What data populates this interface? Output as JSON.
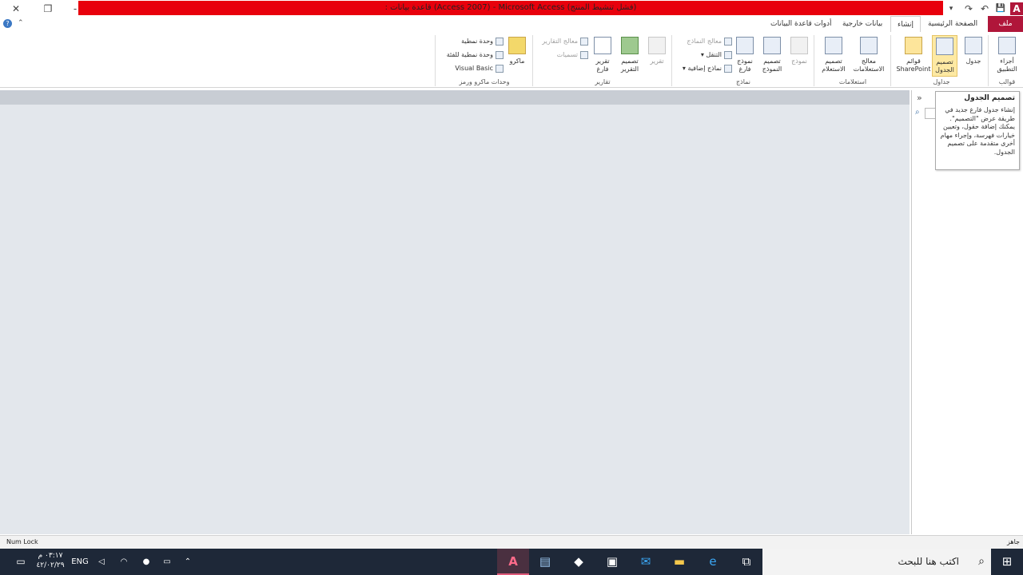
{
  "window": {
    "title": ": قاعدة بيانات  (Access  2007) - Microsoft Access (فشل تنشيط المنتج)",
    "close": "✕",
    "restore": "❐",
    "title_dash": "-",
    "help": "?",
    "qat": [
      "A",
      "💾",
      "↶",
      "↷",
      "▾"
    ]
  },
  "tabs": {
    "file": "ملف",
    "home": "الصفحة الرئيسية",
    "create": "إنشاء",
    "external": "بيانات خارجية",
    "dbtools": "أدوات قاعدة البيانات"
  },
  "ribbon": {
    "templates": {
      "label": "قوالب",
      "app_parts": "أجزاء التطبيق"
    },
    "tables": {
      "label": "جداول",
      "table": "جدول",
      "table_design": "تصميم الجدول",
      "sharepoint_lists": "قوائم SharePoint"
    },
    "queries": {
      "label": "استعلامات",
      "query_wizard": "معالج الاستعلامات",
      "query_design": "تصميم الاستعلام"
    },
    "forms": {
      "label": "نماذج",
      "form": "نموذج",
      "form_design": "تصميم النموذج",
      "blank_form": "نموذج فارغ",
      "form_wizard": "معالج النماذج",
      "navigation": "التنقل",
      "more_forms": "نماذج إضافية"
    },
    "reports": {
      "label": "تقارير",
      "report": "تقرير",
      "report_design": "تصميم التقرير",
      "blank_report": "تقرير فارغ",
      "report_wizard": "معالج التقارير",
      "labels": "تسميات"
    },
    "macros": {
      "label": "وحدات ماكرو ورمز",
      "macro": "ماكرو",
      "module": "وحدة نمطية",
      "class_module": "وحدة نمطية للفئة",
      "visual_basic": "Visual Basic"
    }
  },
  "tooltip": {
    "title": "تصميم الجدول",
    "body": "إنشاء جدول فارغ جديد في طريقة عرض \"التصميم\". يمكنك إضافة حقول، وتعيين خيارات فهرسة، وإجراء مهام أخرى متقدمة على تصميم الجدول."
  },
  "navpane": {
    "collapse": "»"
  },
  "statusbar": {
    "left": "Num Lock",
    "right": "جاهز"
  },
  "taskbar": {
    "search_placeholder": "اكتب هنا للبحث",
    "time": "٠٣:١٧ م",
    "date": "٤٢/٠٢/٢٩",
    "lang": "ENG"
  },
  "colors": {
    "title_bar": "#e8000c",
    "file_tab": "#b0163a",
    "workspace": "#e3e7ec",
    "taskbar": "#1e2838"
  }
}
